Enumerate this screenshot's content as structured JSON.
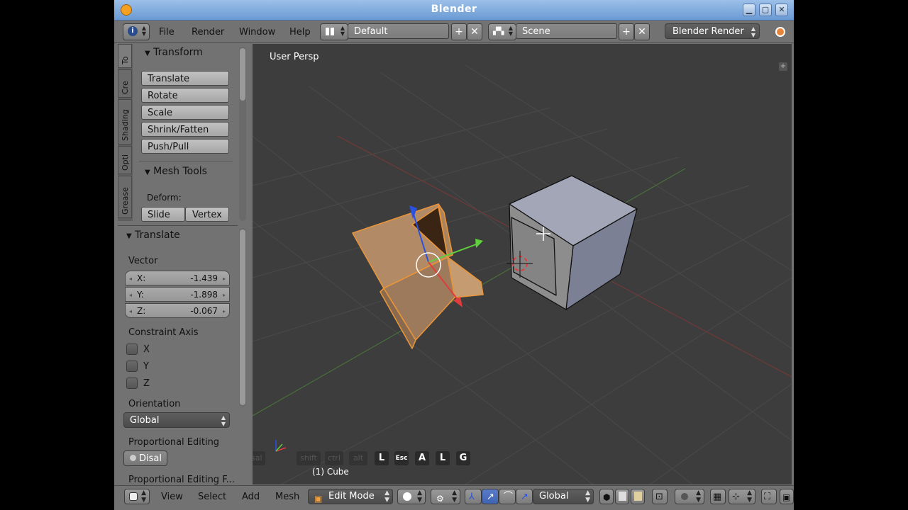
{
  "window": {
    "title": "Blender"
  },
  "menu": {
    "file": "File",
    "render": "Render",
    "window": "Window",
    "help": "Help"
  },
  "screen_layout": {
    "value": "Default"
  },
  "scene": {
    "value": "Scene"
  },
  "renderer": {
    "value": "Blender Render"
  },
  "tabs": [
    "To",
    "Cre",
    "Shading",
    "Opti",
    "Grease"
  ],
  "transform_panel": {
    "title": "Transform",
    "buttons": [
      "Translate",
      "Rotate",
      "Scale",
      "Shrink/Fatten",
      "Push/Pull"
    ]
  },
  "mesh_tools": {
    "title": "Mesh Tools",
    "deform_label": "Deform:",
    "slide_edge": "Slide Ed",
    "vertex": "Vertex"
  },
  "last_operator": {
    "title": "Translate",
    "vector_label": "Vector",
    "x_label": "X:",
    "x_value": "-1.439",
    "y_label": "Y:",
    "y_value": "-1.898",
    "z_label": "Z:",
    "z_value": "-0.067",
    "constraint_label": "Constraint Axis",
    "axis_x": "X",
    "axis_y": "Y",
    "axis_z": "Z",
    "orientation_label": "Orientation",
    "orientation_value": "Global",
    "proportional_label": "Proportional Editing",
    "proportional_value": "Disal",
    "proportional_falloff_label": "Proportional Editing F..."
  },
  "viewport": {
    "view_label": "User Persp",
    "object_label": "(1) Cube",
    "key_overlay": [
      "L",
      "Esc",
      "A",
      "L",
      "G"
    ]
  },
  "bottom": {
    "view": "View",
    "select": "Select",
    "add": "Add",
    "mesh": "Mesh",
    "mode": "Edit Mode",
    "orientation": "Global"
  },
  "colors": {
    "title_bar": "#7ba7dc",
    "ui_gray": "#727272",
    "viewport_bg": "#3d3d3d",
    "selection_orange": "#e8943a",
    "axis_red": "#e03c3c",
    "axis_green": "#5fd03b",
    "axis_blue": "#2a52e0"
  }
}
